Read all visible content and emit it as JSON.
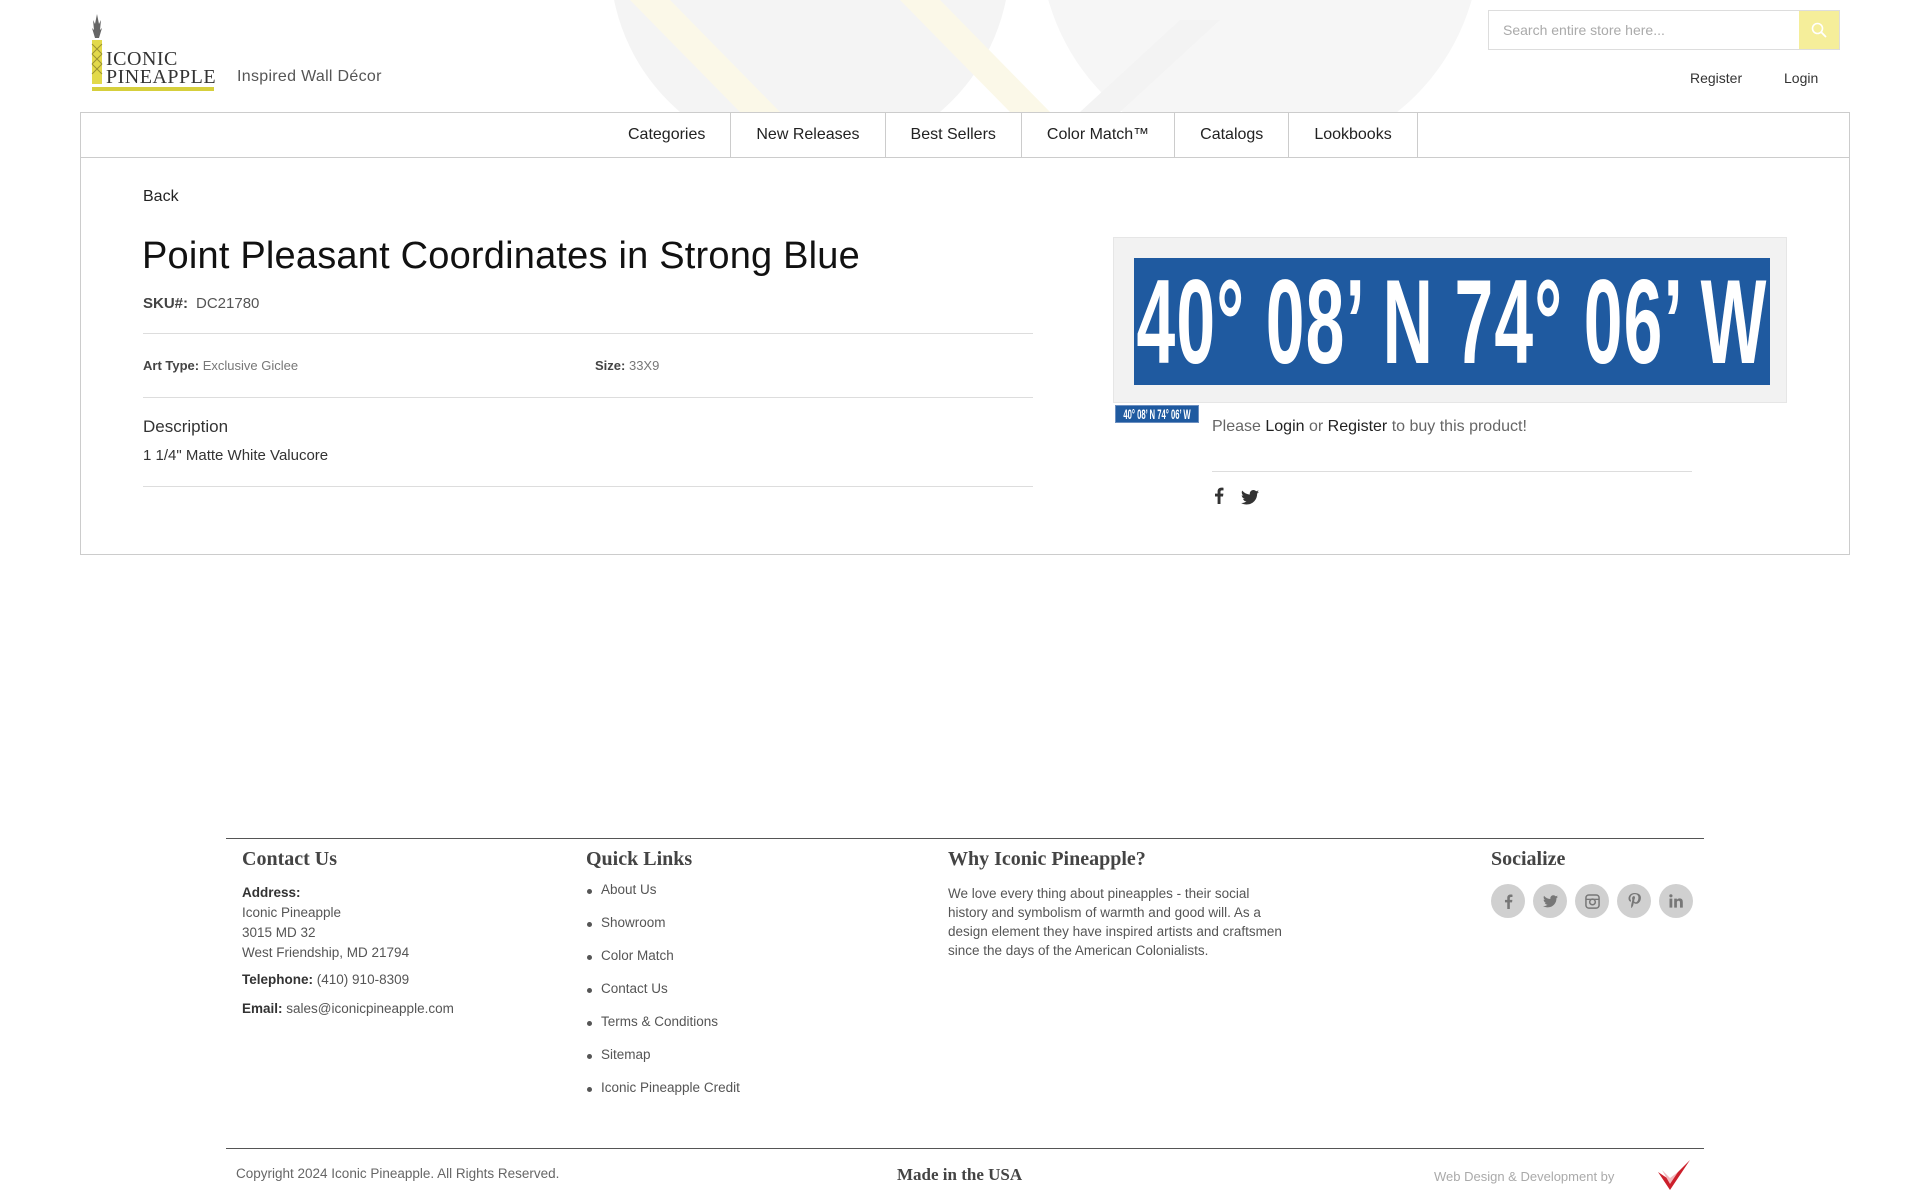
{
  "brand": {
    "logo_line1": "ICONIC",
    "logo_line2": "PINEAPPLE",
    "tagline": "Inspired Wall Décor",
    "accent_color": "#d6cf3c"
  },
  "header": {
    "search": {
      "placeholder": "Search entire store here...",
      "icon": "search-icon"
    },
    "register_label": "Register",
    "login_label": "Login"
  },
  "nav": {
    "items": [
      {
        "label": "Categories"
      },
      {
        "label": "New Releases"
      },
      {
        "label": "Best Sellers"
      },
      {
        "label": "Color Match™"
      },
      {
        "label": "Catalogs"
      },
      {
        "label": "Lookbooks"
      }
    ]
  },
  "product": {
    "back_label": "Back",
    "title": "Point Pleasant Coordinates in Strong Blue",
    "sku_label": "SKU#:",
    "sku_value": "DC21780",
    "art_type_label": "Art Type:",
    "art_type_value": "Exclusive Giclee",
    "size_label": "Size:",
    "size_value": "33X9",
    "description_heading": "Description",
    "description_value": "1 1/4\" Matte White Valucore",
    "image_text": "40° 08’ N 74° 06’ W",
    "image_color": "#1f5aa0",
    "buy_prefix": "Please",
    "buy_login": "Login",
    "buy_or": "or",
    "buy_register": "Register",
    "buy_suffix": "to buy this product!",
    "share_icons": [
      "facebook-icon",
      "twitter-icon"
    ]
  },
  "footer": {
    "contact": {
      "heading": "Contact Us",
      "address_label": "Address:",
      "address_lines": [
        "Iconic Pineapple",
        "3015 MD 32",
        "West Friendship, MD 21794"
      ],
      "telephone_label": "Telephone:",
      "telephone_value": "(410) 910-8309",
      "email_label": "Email:",
      "email_value": "sales@iconicpineapple.com"
    },
    "quick_links": {
      "heading": "Quick Links",
      "items": [
        "About Us",
        "Showroom",
        "Color Match",
        "Contact Us",
        "Terms & Conditions",
        "Sitemap",
        "Iconic Pineapple Credit"
      ]
    },
    "why": {
      "heading": "Why Iconic Pineapple?",
      "text": "We love every thing about pineapples - their social history and symbolism of warmth and good will. As a design element they have inspired artists and craftsmen since the days of the American Colonialists."
    },
    "socialize": {
      "heading": "Socialize",
      "icons": [
        "facebook-icon",
        "twitter-icon",
        "instagram-icon",
        "pinterest-icon",
        "linkedin-icon"
      ]
    },
    "copyright": "Copyright 2024 Iconic Pineapple. All Rights Reserved.",
    "made_in": "Made in the USA",
    "credit": "Web Design & Development by"
  }
}
